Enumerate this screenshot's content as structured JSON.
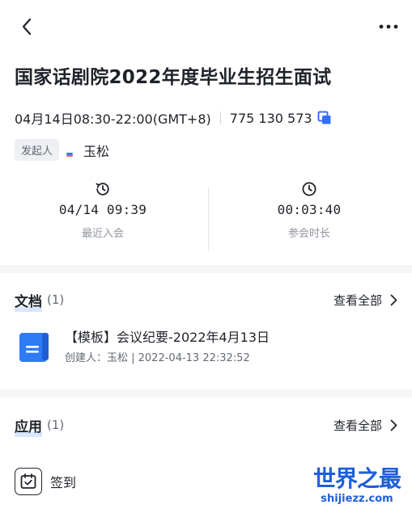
{
  "header": {
    "back_icon": "chevron-left-icon",
    "more_icon": "more-horizontal-icon"
  },
  "meeting": {
    "title": "国家话剧院2022年度毕业生招生面试",
    "time": "04月14日08:30-22:00(GMT+8)",
    "meeting_id": "775 130 573",
    "copy_icon": "copy-icon",
    "host_tag": "发起人",
    "host_name": "玉松"
  },
  "stats": {
    "recent_join": {
      "value": "04/14 09:39",
      "label": "最近入会",
      "icon": "history-clock-icon"
    },
    "duration": {
      "value": "00:03:40",
      "label": "参会时长",
      "icon": "clock-icon"
    }
  },
  "documents": {
    "title": "文档",
    "count": "(1)",
    "view_all": "查看全部",
    "items": [
      {
        "title": "【模板】会议纪要-2022年4月13日",
        "meta": "创建人：玉松 | 2022-04-13 22:32:52",
        "icon": "doc-file-icon"
      }
    ]
  },
  "apps": {
    "title": "应用",
    "count": "(1)",
    "view_all": "查看全部",
    "items": [
      {
        "label": "签到",
        "icon": "checkin-calendar-icon"
      }
    ]
  },
  "watermark": {
    "main": "世界之最",
    "sub": "shijiezz.com"
  },
  "colors": {
    "accent": "#3370ff",
    "doc_blue": "#2f7bf5",
    "watermark": "#1e5fd8",
    "divider": "#f5f6f7",
    "muted_text": "#8f959e"
  }
}
